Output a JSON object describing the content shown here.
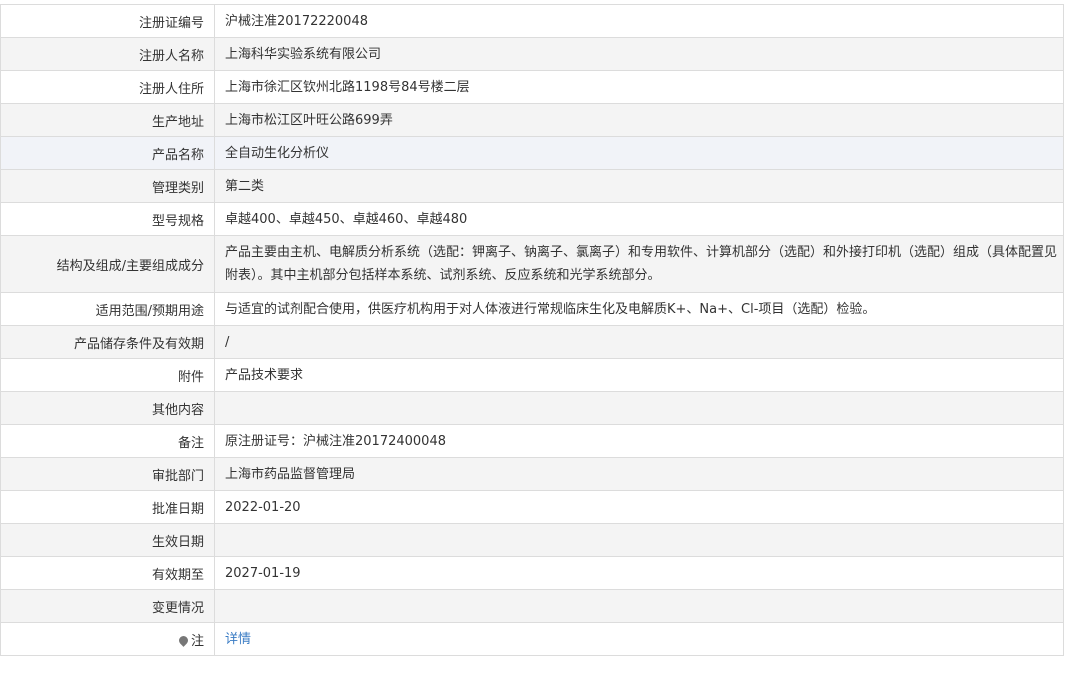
{
  "rows": [
    {
      "label": "注册证编号",
      "value": "沪械注准20172220048"
    },
    {
      "label": "注册人名称",
      "value": "上海科华实验系统有限公司"
    },
    {
      "label": "注册人住所",
      "value": "上海市徐汇区钦州北路1198号84号楼二层"
    },
    {
      "label": "生产地址",
      "value": "上海市松江区叶旺公路699弄"
    },
    {
      "label": "产品名称",
      "value": "全自动生化分析仪"
    },
    {
      "label": "管理类别",
      "value": "第二类"
    },
    {
      "label": "型号规格",
      "value": "卓越400、卓越450、卓越460、卓越480"
    },
    {
      "label": "结构及组成/主要组成成分",
      "value": "产品主要由主机、电解质分析系统（选配：钾离子、钠离子、氯离子）和专用软件、计算机部分（选配）和外接打印机（选配）组成（具体配置见附表）。其中主机部分包括样本系统、试剂系统、反应系统和光学系统部分。"
    },
    {
      "label": "适用范围/预期用途",
      "value": "与适宜的试剂配合使用，供医疗机构用于对人体液进行常规临床生化及电解质K+、Na+、Cl-项目（选配）检验。"
    },
    {
      "label": "产品储存条件及有效期",
      "value": "/"
    },
    {
      "label": "附件",
      "value": "产品技术要求"
    },
    {
      "label": "其他内容",
      "value": ""
    },
    {
      "label": "备注",
      "value": "原注册证号：沪械注准20172400048"
    },
    {
      "label": "审批部门",
      "value": "上海市药品监督管理局"
    },
    {
      "label": "批准日期",
      "value": "2022-01-20"
    },
    {
      "label": "生效日期",
      "value": ""
    },
    {
      "label": "有效期至",
      "value": "2027-01-19"
    },
    {
      "label": "变更情况",
      "value": ""
    },
    {
      "label": "注",
      "value": "详情",
      "icon": "map-pin-icon"
    }
  ]
}
